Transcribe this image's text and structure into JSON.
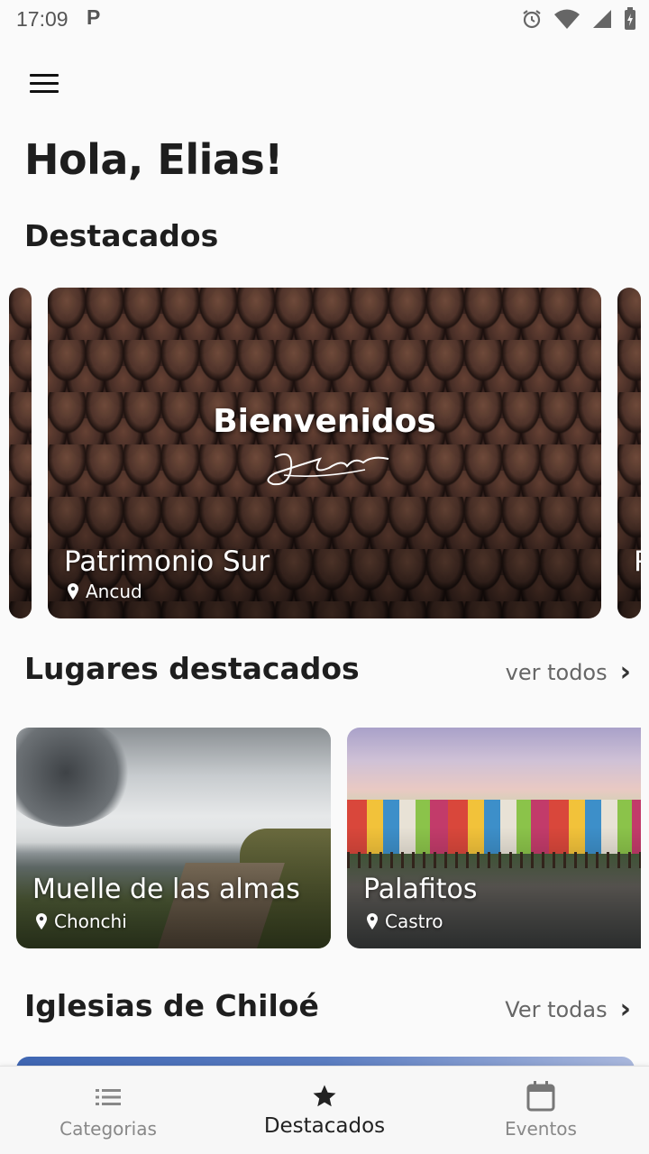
{
  "status_bar": {
    "time": "17:09",
    "notification_icon": "P",
    "icons": [
      "alarm-icon",
      "wifi-icon",
      "signal-icon",
      "battery-charging-icon"
    ]
  },
  "header": {
    "menu_icon": "hamburger-menu-icon",
    "greeting": "Hola, Elias!"
  },
  "featured": {
    "title": "Destacados",
    "cards": [
      {
        "overlay_heading": "Bienvenidos",
        "title": "Patrimonio Sur",
        "location": "Ancud"
      },
      {
        "title": "P"
      }
    ]
  },
  "places": {
    "title": "Lugares destacados",
    "see_all": "ver todos",
    "items": [
      {
        "title": "Muelle de las almas",
        "location": "Chonchi"
      },
      {
        "title": "Palafitos",
        "location": "Castro"
      }
    ]
  },
  "churches": {
    "title": "Iglesias de Chiloé",
    "see_all": "Ver todas"
  },
  "bottom_nav": {
    "items": [
      {
        "label": "Categorias",
        "icon": "list-icon",
        "active": false
      },
      {
        "label": "Destacados",
        "icon": "star-icon",
        "active": true
      },
      {
        "label": "Eventos",
        "icon": "calendar-icon",
        "active": false
      }
    ]
  },
  "colors": {
    "background": "#fafafa",
    "text_primary": "#1e1e1e",
    "text_secondary": "#666666",
    "nav_inactive": "#888888"
  }
}
